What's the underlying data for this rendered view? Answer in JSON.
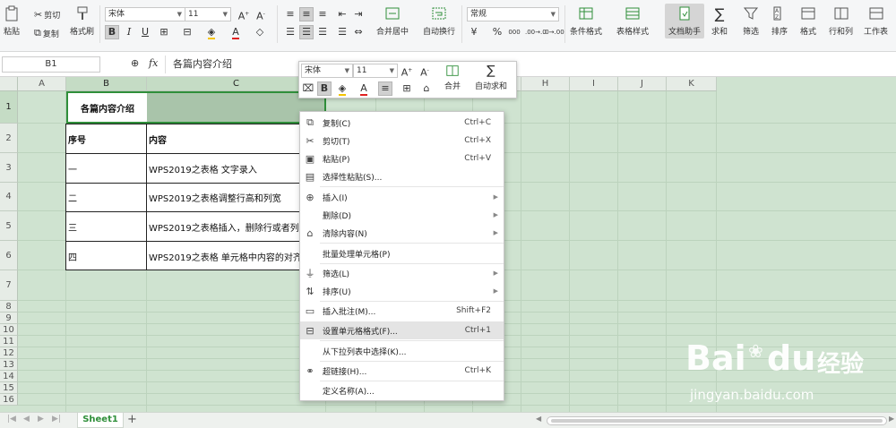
{
  "ribbon": {
    "paste": "粘贴",
    "cut": "剪切",
    "copy": "复制",
    "format_painter": "格式刷",
    "font_name": "宋体",
    "font_size": "11",
    "merge_center": "合并居中",
    "wrap_text": "自动换行",
    "number_format": "常规",
    "conditional_format": "条件格式",
    "table_style": "表格样式",
    "doc_helper": "文档助手",
    "sum": "求和",
    "filter": "筛选",
    "sort": "排序",
    "format": "格式",
    "row_col": "行和列",
    "worksheet": "工作表",
    "decimal_inc": ".00→.0",
    "decimal_dec": ".0→.00",
    "thousands": "000"
  },
  "formula_bar": {
    "name_box": "B1",
    "fx": "fx",
    "content": "各篇内容介绍"
  },
  "columns": [
    "A",
    "B",
    "C",
    "D",
    "E",
    "F",
    "G",
    "H",
    "I",
    "J",
    "K"
  ],
  "rows": [
    "1",
    "2",
    "3",
    "4",
    "5",
    "6",
    "7",
    "8",
    "9",
    "10",
    "11",
    "12",
    "13",
    "14",
    "15",
    "16"
  ],
  "cells": {
    "b1": "各篇内容介绍",
    "b2": "序号",
    "c2": "内容",
    "b3": "一",
    "c3": "WPS2019之表格 文字录入",
    "b4": "二",
    "c4": "WPS2019之表格调整行高和列宽",
    "b5": "三",
    "c5": "WPS2019之表格插入，删除行或者列",
    "b6": "四",
    "c6": "WPS2019之表格   单元格中内容的对齐"
  },
  "mini_toolbar": {
    "font_name": "宋体",
    "font_size": "11",
    "merge": "合并",
    "autosum": "自动求和"
  },
  "context_menu": [
    {
      "label": "复制(C)",
      "shortcut": "Ctrl+C"
    },
    {
      "label": "剪切(T)",
      "shortcut": "Ctrl+X"
    },
    {
      "label": "粘贴(P)",
      "shortcut": "Ctrl+V"
    },
    {
      "label": "选择性粘贴(S)...",
      "shortcut": ""
    },
    {
      "label": "插入(I)",
      "shortcut": ""
    },
    {
      "label": "删除(D)",
      "shortcut": ""
    },
    {
      "label": "清除内容(N)",
      "shortcut": ""
    },
    {
      "label": "批量处理单元格(P)",
      "shortcut": ""
    },
    {
      "label": "筛选(L)",
      "shortcut": ""
    },
    {
      "label": "排序(U)",
      "shortcut": ""
    },
    {
      "label": "插入批注(M)...",
      "shortcut": "Shift+F2"
    },
    {
      "label": "设置单元格格式(F)...",
      "shortcut": "Ctrl+1"
    },
    {
      "label": "从下拉列表中选择(K)...",
      "shortcut": ""
    },
    {
      "label": "超链接(H)...",
      "shortcut": "Ctrl+K"
    },
    {
      "label": "定义名称(A)...",
      "shortcut": ""
    }
  ],
  "sheet_tabs": {
    "active": "Sheet1",
    "add": "+"
  },
  "watermark": {
    "brand": "Bai",
    "brand2": "du",
    "cn": "经验",
    "url": "jingyan.baidu.com"
  },
  "colors": {
    "grid_bg": "#cfe3d0",
    "accent_green": "#2f8f3a",
    "menu_highlight": "#e4e4e4"
  }
}
